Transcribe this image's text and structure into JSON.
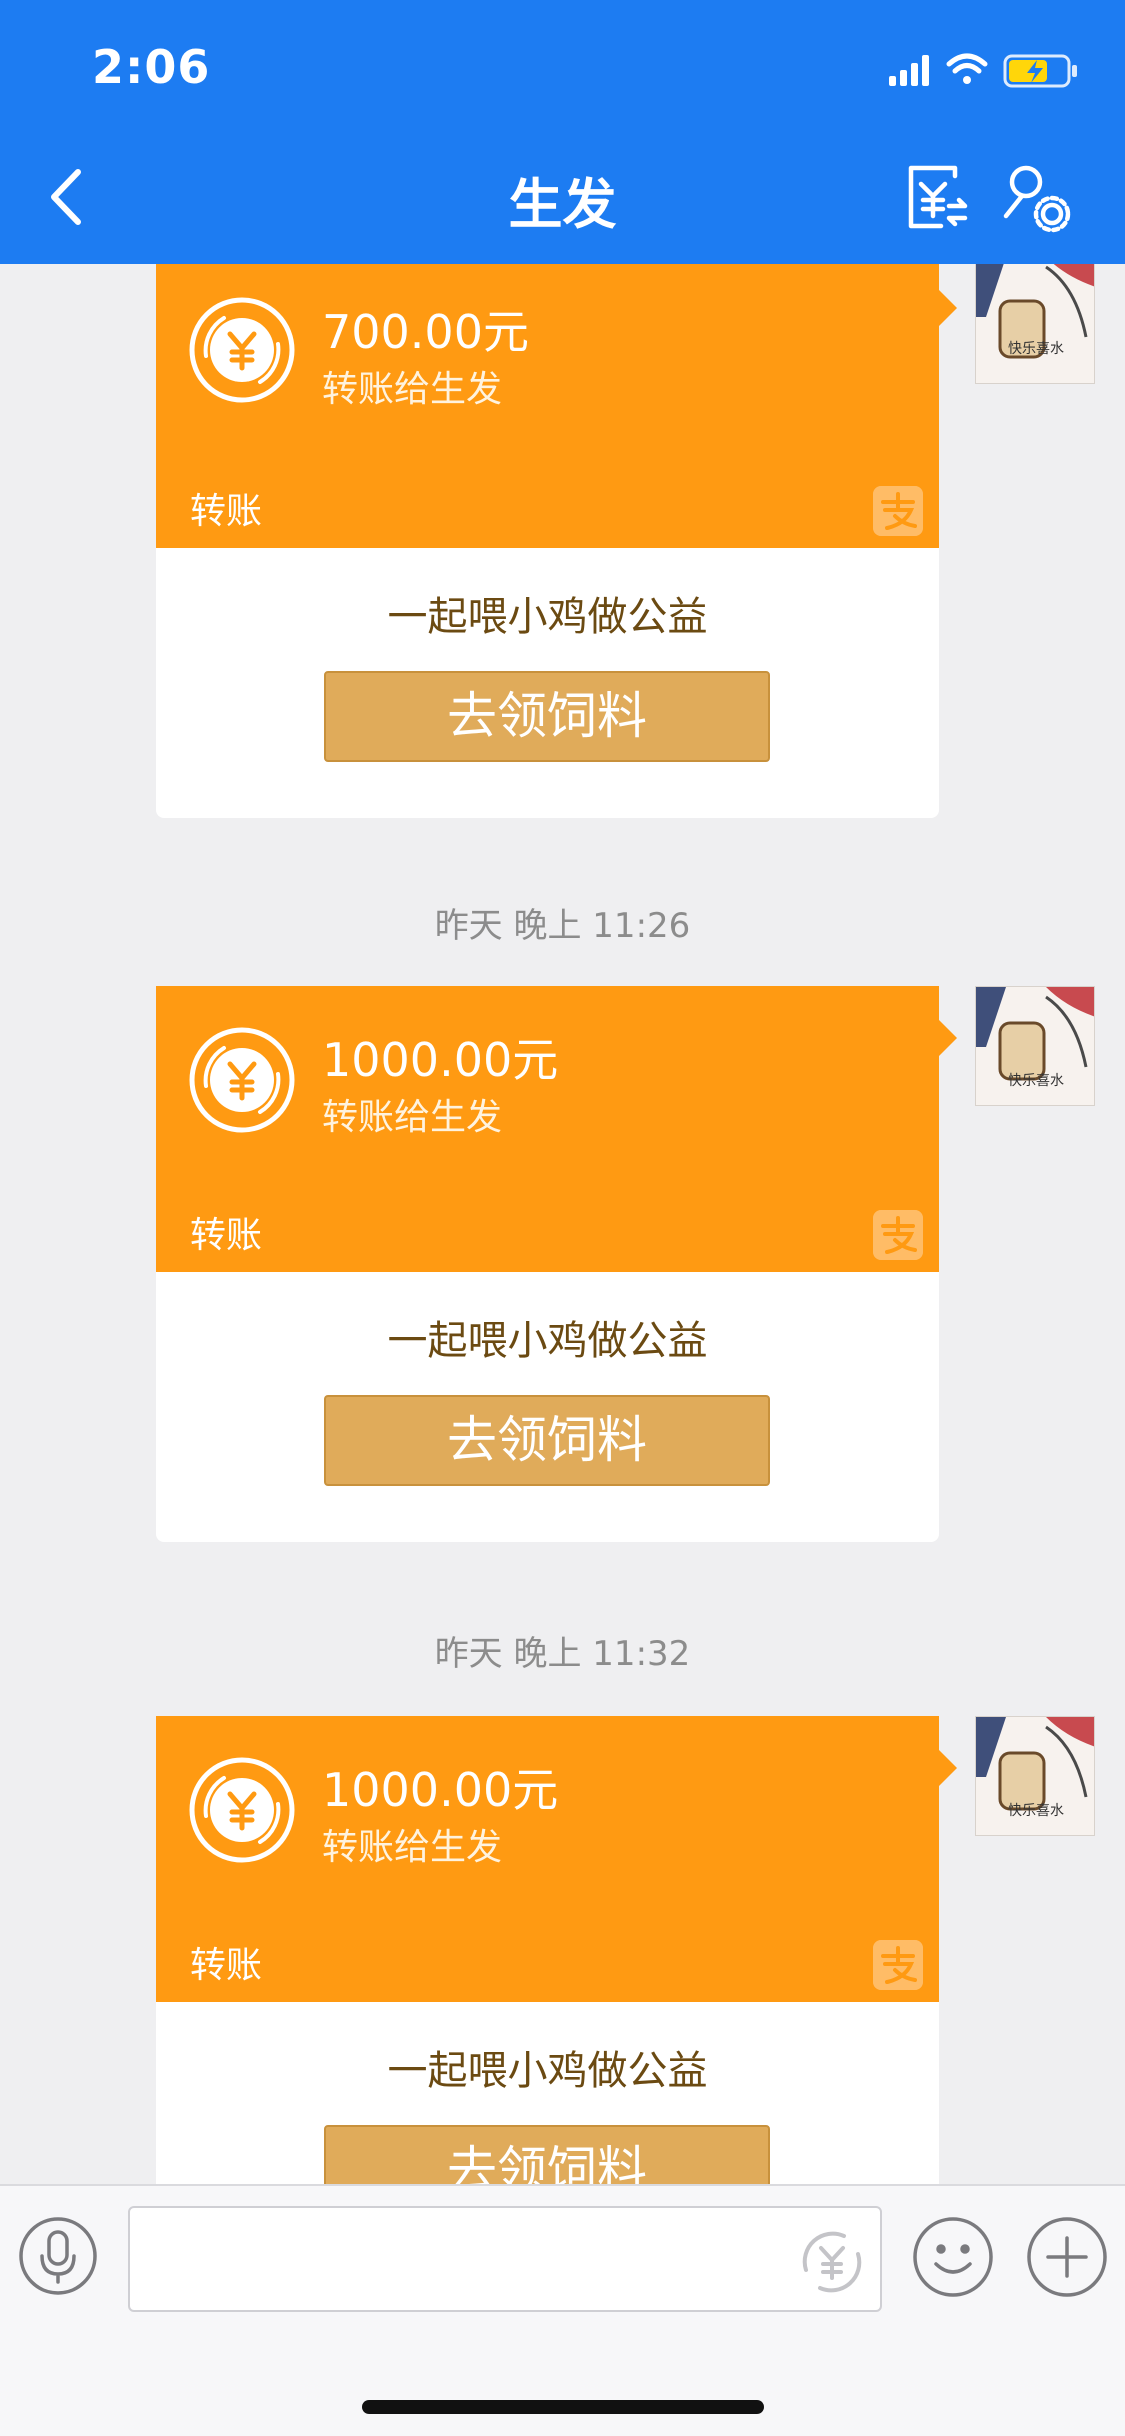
{
  "status_bar": {
    "time": "2:06"
  },
  "header": {
    "title": "生发"
  },
  "colors": {
    "header": "#1d7cf2",
    "card": "#ff9a12",
    "button": "#e0ab5a"
  },
  "messages": [
    {
      "amount": "700.00元",
      "sub": "转账给生发",
      "label": "转账",
      "promo": "一起喂小鸡做公益",
      "button": "去领饲料",
      "avatar_text": "快乐喜水"
    },
    {
      "amount": "1000.00元",
      "sub": "转账给生发",
      "label": "转账",
      "promo": "一起喂小鸡做公益",
      "button": "去领饲料",
      "avatar_text": "快乐喜水"
    },
    {
      "amount": "1000.00元",
      "sub": "转账给生发",
      "label": "转账",
      "promo": "一起喂小鸡做公益",
      "button": "去领饲料",
      "avatar_text": "快乐喜水"
    }
  ],
  "timestamps": [
    "昨天 晚上 11:26",
    "昨天 晚上 11:32"
  ],
  "icons": {
    "back": "chevron-left-icon",
    "transfer": "yuan-transfer-icon",
    "profile": "user-settings-icon",
    "voice": "microphone-icon",
    "yuan": "yuan-icon",
    "emoji": "smiley-icon",
    "plus": "plus-icon",
    "alipay": "alipay-icon"
  }
}
